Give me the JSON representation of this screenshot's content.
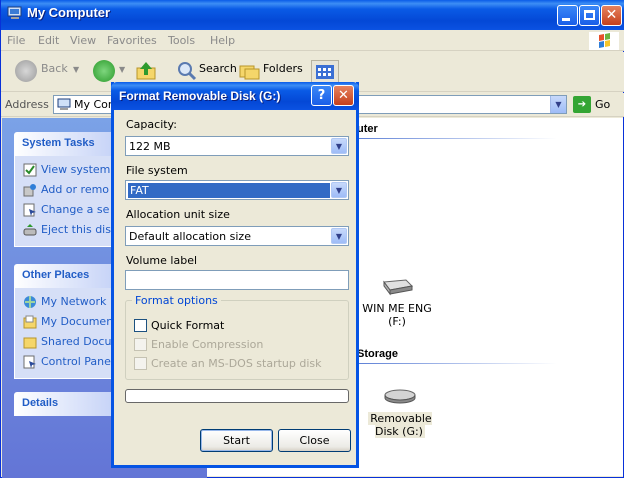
{
  "window": {
    "title": "My Computer"
  },
  "menu": [
    "File",
    "Edit",
    "View",
    "Favorites",
    "Tools",
    "Help"
  ],
  "toolbar": {
    "back": "Back",
    "search": "Search",
    "folders": "Folders"
  },
  "address": {
    "label": "Address",
    "value": "My Com",
    "go": "Go"
  },
  "sidebar": {
    "system_tasks": {
      "title": "System Tasks",
      "items": [
        "View system",
        "Add or remo",
        "Change a se",
        "Eject this dis"
      ]
    },
    "other_places": {
      "title": "Other Places",
      "items": [
        "My Network",
        "My Documen",
        "Shared Docu",
        "Control Pane"
      ]
    },
    "details": {
      "title": "Details"
    }
  },
  "content": {
    "group1": "uter",
    "group2": "Storage",
    "drive_f": "WIN ME ENG\n(F:)",
    "drive_g": "Removable\nDisk (G:)"
  },
  "dialog": {
    "title": "Format Removable Disk (G:)",
    "help_btn": "?",
    "capacity_label": "Capacity:",
    "capacity_value": "122 MB",
    "fs_label": "File system",
    "fs_value": "FAT",
    "alloc_label": "Allocation unit size",
    "alloc_value": "Default allocation size",
    "volume_label": "Volume label",
    "volume_value": "",
    "options_legend": "Format options",
    "quick_format": "Quick Format",
    "compression": "Enable Compression",
    "msdos": "Create an MS-DOS startup disk",
    "progress": 0,
    "start": "Start",
    "close": "Close"
  },
  "colors": {
    "xp_blue": "#0a5be6",
    "selection": "#316ac5",
    "task_link": "#215dc6",
    "close_red": "#c5401c"
  }
}
